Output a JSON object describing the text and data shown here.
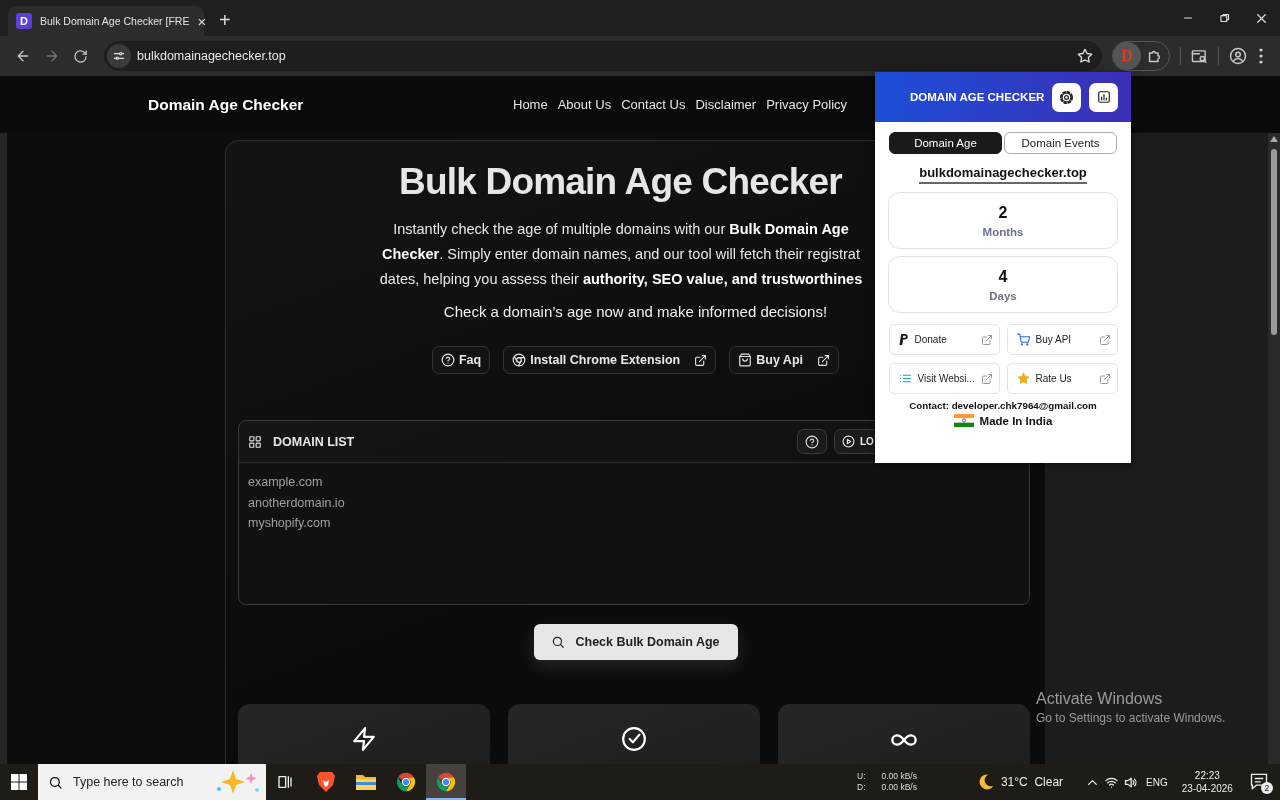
{
  "browser": {
    "favicon": "D",
    "tab_title": "Bulk Domain Age Checker [FRE",
    "tab_close": "×",
    "new_tab": "+",
    "url": "bulkdomainagechecker.top",
    "extension_badge": "D"
  },
  "site": {
    "brand": "Domain Age Checker",
    "nav": [
      "Home",
      "About Us",
      "Contact Us",
      "Disclaimer",
      "Privacy Policy"
    ]
  },
  "hero": {
    "title": "Bulk Domain Age Checker",
    "lines": [
      "Instantly check the age of multiple domains with our **Bulk Domain Age**",
      "**Checker**. Simply enter domain names, and our tool will fetch their registrat",
      "dates, helping you assess their **authority, SEO value, and trustworthines**"
    ],
    "tagline": "Check a domain’s age now and make informed decisions!",
    "buttons": [
      {
        "label": "Faq",
        "external": false
      },
      {
        "label": "Install Chrome Extension",
        "external": true
      },
      {
        "label": "Buy Api",
        "external": true
      }
    ]
  },
  "domain_list": {
    "title": "DOMAIN LIST",
    "load_button": "LO",
    "placeholder": "example.com\nanotherdomain.io\nmyshopify.com"
  },
  "check_button": "Check Bulk Domain Age",
  "popup": {
    "title": "DOMAIN AGE CHECKER",
    "tabs": [
      {
        "label": "Domain Age",
        "selected": true
      },
      {
        "label": "Domain Events",
        "selected": false
      }
    ],
    "domain": "bulkdomainagechecker.top",
    "stats": [
      {
        "value": "2",
        "unit": "Months"
      },
      {
        "value": "4",
        "unit": "Days"
      }
    ],
    "links": [
      {
        "label": "Donate"
      },
      {
        "label": "Buy API"
      },
      {
        "label": "Visit Websi..."
      },
      {
        "label": "Rate Us"
      }
    ],
    "contact": "Contact: developer.chk7964@gmail.com",
    "made_in": "Made In India"
  },
  "os_notice": {
    "title": "Activate Windows",
    "subtitle": "Go to Settings to activate Windows."
  },
  "taskbar": {
    "search_placeholder": "Type here to search",
    "apps": [
      {
        "selected": false
      },
      {
        "selected": false
      },
      {
        "selected": false
      },
      {
        "selected": true
      }
    ],
    "net": [
      {
        "label": "U:",
        "value": "0.00 kB/s"
      },
      {
        "label": "D:",
        "value": "0.00 kB/s"
      }
    ],
    "weather": "31°C  Clear",
    "lang": "ENG",
    "time": "22:23",
    "date": "23-04-2026",
    "notifications": "2"
  }
}
